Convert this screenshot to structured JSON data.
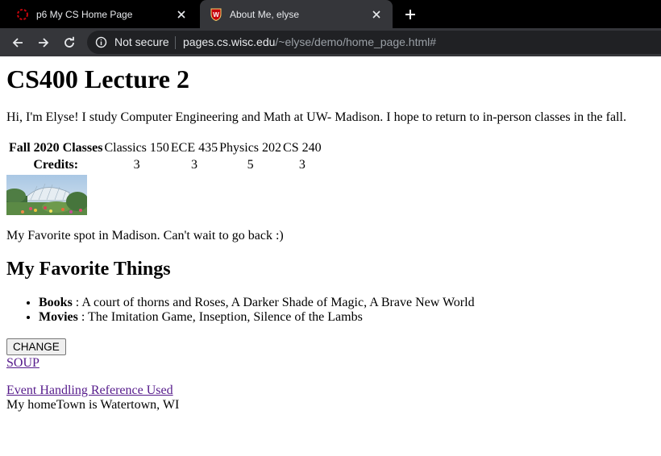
{
  "browser": {
    "tabs": [
      {
        "title": "p6 My CS Home Page",
        "icon": "loading-ring-icon",
        "active": false
      },
      {
        "title": "About Me, elyse",
        "icon": "uw-crest-icon",
        "active": true
      }
    ],
    "security_label": "Not secure",
    "url_host": "pages.cs.wisc.edu",
    "url_path": "/~elyse/demo/home_page.html#",
    "colors": {
      "tabstrip": "#000000",
      "toolbar": "#35363a",
      "omnibox": "#202124",
      "accent_red": "#c5050c"
    }
  },
  "page": {
    "title": "CS400 Lecture 2",
    "intro": "Hi, I'm Elyse! I study Computer Engineering and Math at UW- Madison. I hope to return to in-person classes in the fall.",
    "classes_table": {
      "row_header": "Fall 2020 Classes",
      "classes": [
        "Classics 150",
        "ECE 435",
        "Physics 202",
        "CS 240"
      ],
      "credits_header": "Credits:",
      "credits": [
        "3",
        "3",
        "5",
        "3"
      ]
    },
    "photo_icon": "conservatory-photo",
    "photo_caption": "My Favorite spot in Madison. Can't wait to go back :)",
    "favorites_heading": "My Favorite Things",
    "favorites": [
      {
        "label": "Books",
        "value": " : A court of thorns and Roses, A Darker Shade of Magic, A Brave New World"
      },
      {
        "label": "Movies",
        "value": " : The Imitation Game, Inseption, Silence of the Lambs"
      }
    ],
    "change_button": "CHANGE",
    "soup_link": "SOUP",
    "reference_link": "Event Handling Reference Used",
    "hometown": "My homeTown is Watertown, WI",
    "link_color": "#551a8b"
  }
}
